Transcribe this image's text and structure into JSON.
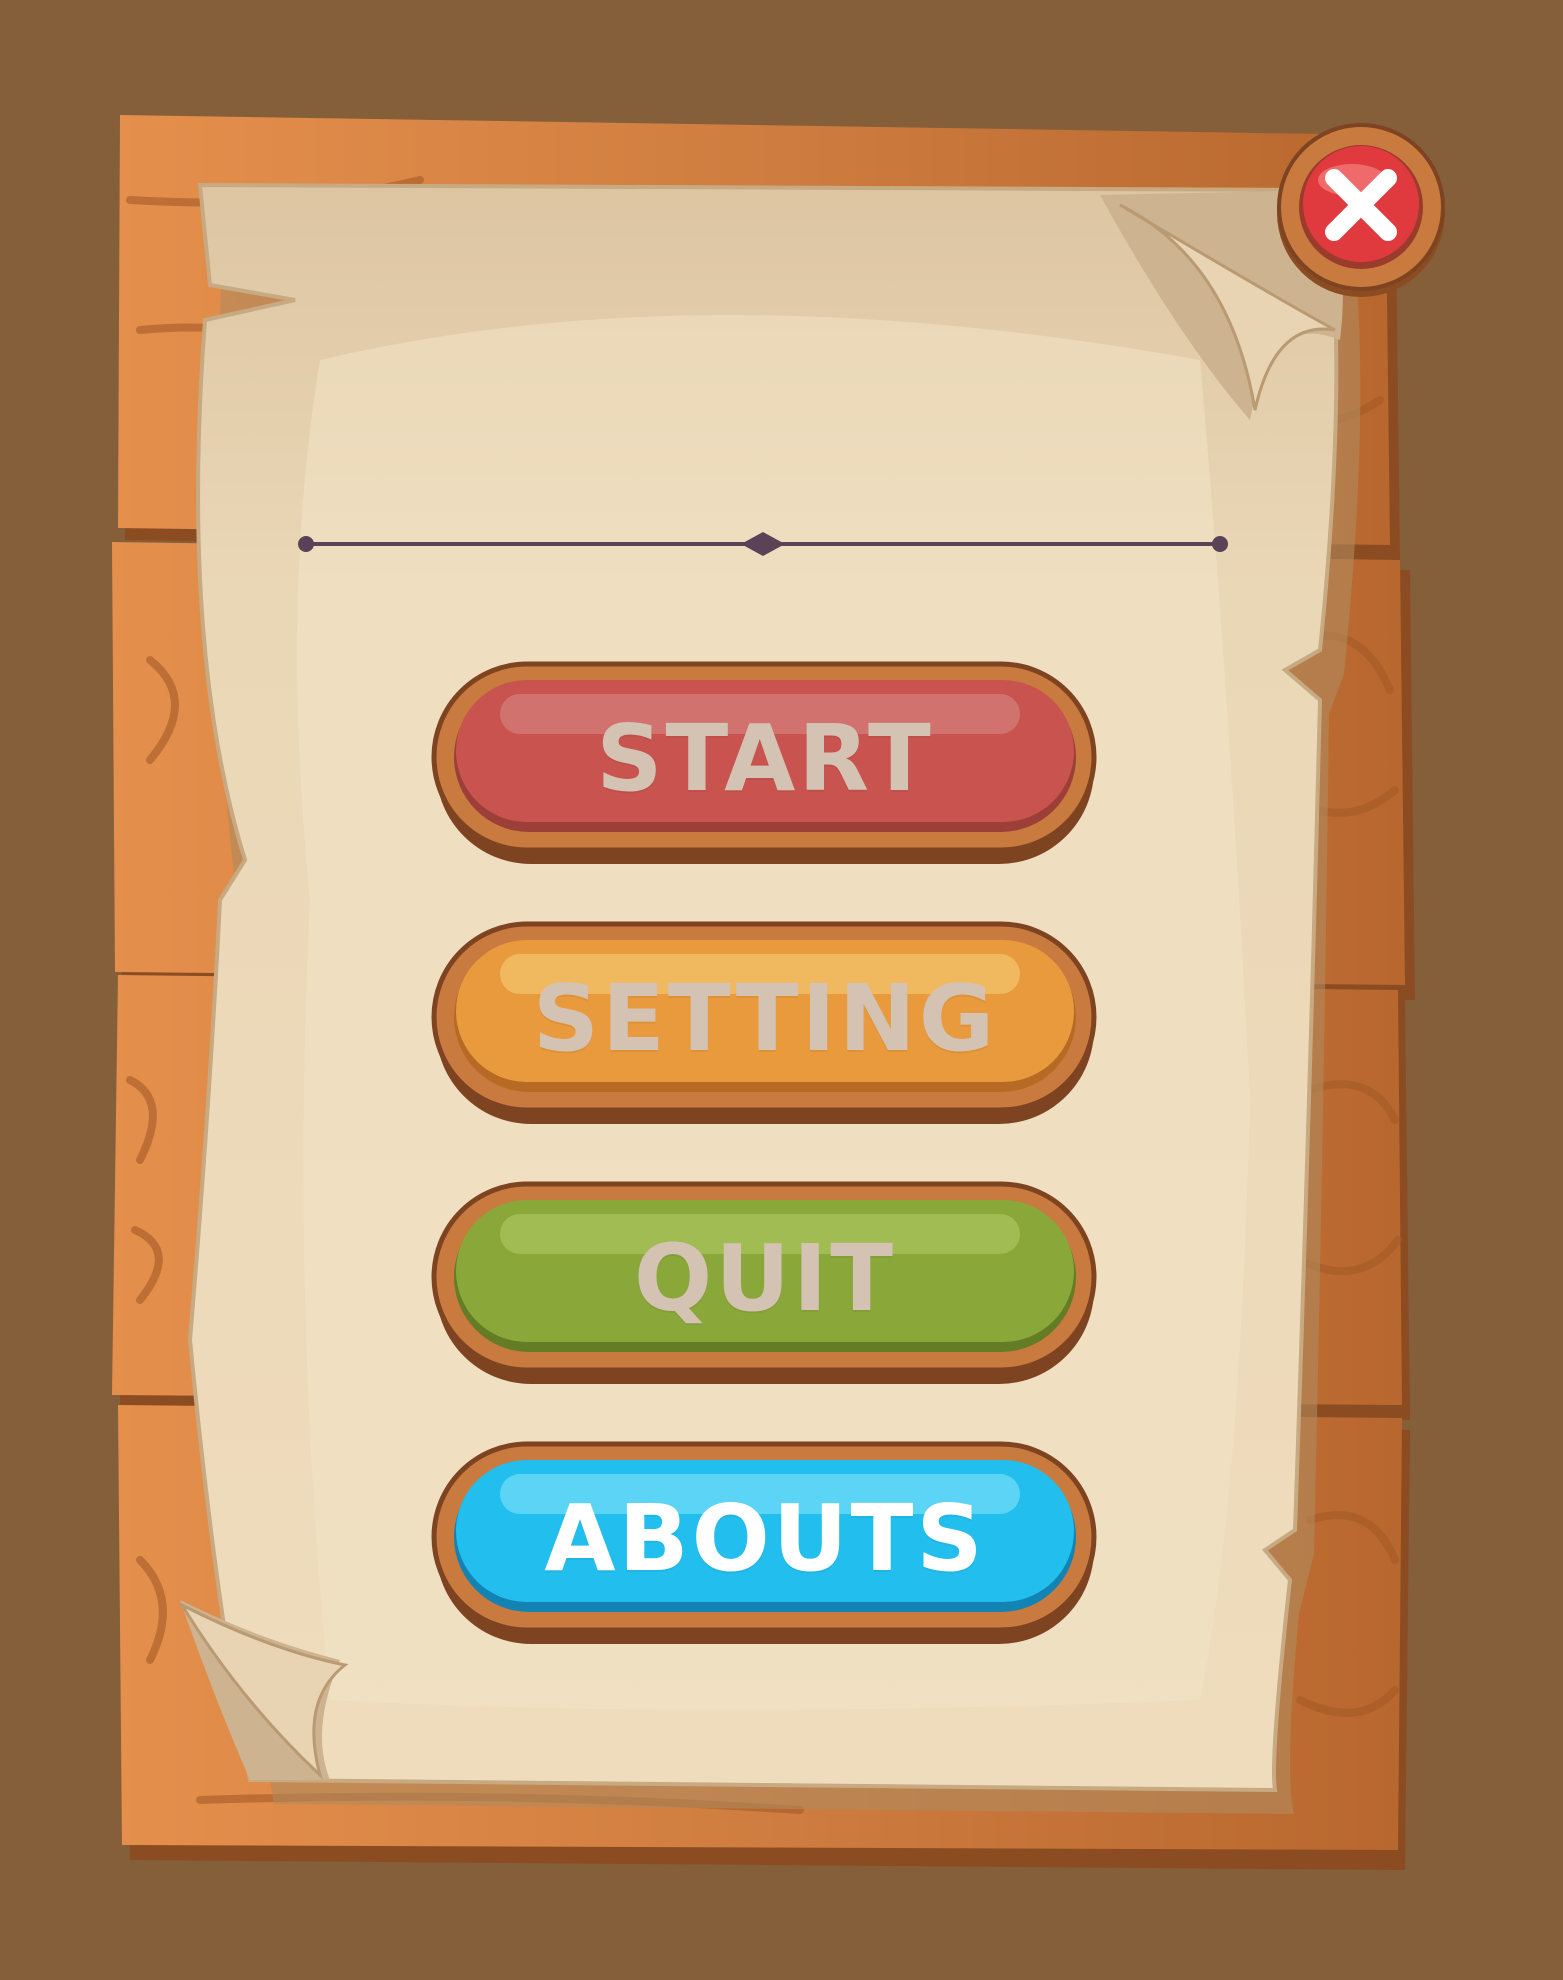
{
  "screen": {
    "name": "main-menu",
    "colors": {
      "background": "#855f3a",
      "wood": "#c97a3f",
      "parchment": "#ead8b8",
      "divider": "#5a4257"
    }
  },
  "close_button": {
    "icon": "close-icon",
    "color": "#e03a3f"
  },
  "menu": {
    "items": [
      {
        "label": "START",
        "color": "#c9544f",
        "text_color": "#d4c3b3"
      },
      {
        "label": "SETTING",
        "color": "#e99a3c",
        "text_color": "#d4c3b3"
      },
      {
        "label": "QUIT",
        "color": "#8aa83a",
        "text_color": "#d4c3b3"
      },
      {
        "label": "ABOUTS",
        "color": "#22bfee",
        "text_color": "#ffffff"
      }
    ]
  }
}
